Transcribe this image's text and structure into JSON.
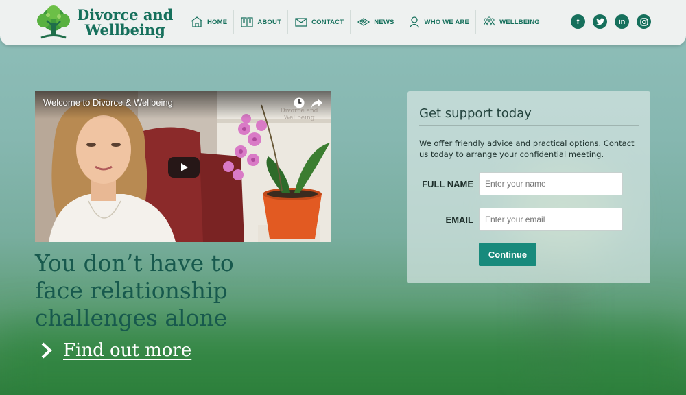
{
  "brand": {
    "name_line1": "Divorce and",
    "name_line2": "Wellbeing",
    "color": "#16705c"
  },
  "nav": [
    {
      "label": "HOME",
      "icon": "home-icon"
    },
    {
      "label": "ABOUT",
      "icon": "book-icon"
    },
    {
      "label": "CONTACT",
      "icon": "envelope-icon"
    },
    {
      "label": "NEWS",
      "icon": "newspaper-icon"
    },
    {
      "label": "WHO WE ARE",
      "icon": "person-icon"
    },
    {
      "label": "WELLBEING",
      "icon": "people-icon"
    }
  ],
  "social": [
    {
      "name": "facebook-icon",
      "glyph": "f"
    },
    {
      "name": "twitter-icon",
      "glyph": "t"
    },
    {
      "name": "linkedin-icon",
      "glyph": "in"
    },
    {
      "name": "instagram-icon",
      "glyph": "◎"
    }
  ],
  "video": {
    "title": "Welcome to Divorce & Wellbeing",
    "watermark_line1": "Divorce and",
    "watermark_line2": "Wellbeing"
  },
  "hero": {
    "headline": "You don’t have to face relationship challenges alone",
    "cta": "Find out more"
  },
  "form": {
    "title": "Get support today",
    "description": "We offer friendly advice and practical options. Contact us today to arrange your confidential meeting.",
    "name_label": "FULL NAME",
    "name_placeholder": "Enter your name",
    "email_label": "EMAIL",
    "email_placeholder": "Enter your email",
    "submit_label": "Continue",
    "accent": "#188a7c"
  }
}
